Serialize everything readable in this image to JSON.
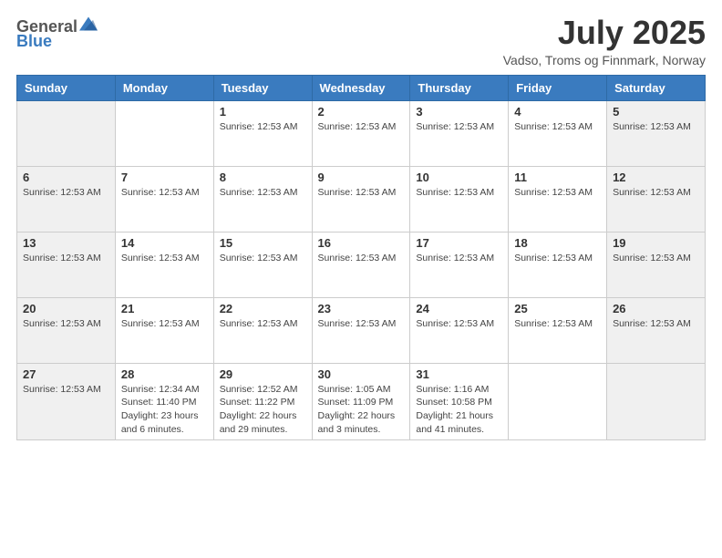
{
  "header": {
    "logo": {
      "general": "General",
      "blue": "Blue",
      "icon_title": "GeneralBlue Logo"
    },
    "title": "July 2025",
    "subtitle": "Vadso, Troms og Finnmark, Norway"
  },
  "weekdays": [
    "Sunday",
    "Monday",
    "Tuesday",
    "Wednesday",
    "Thursday",
    "Friday",
    "Saturday"
  ],
  "weeks": [
    [
      {
        "day": "",
        "info": ""
      },
      {
        "day": "",
        "info": ""
      },
      {
        "day": "1",
        "info": "Sunrise: 12:53 AM"
      },
      {
        "day": "2",
        "info": "Sunrise: 12:53 AM"
      },
      {
        "day": "3",
        "info": "Sunrise: 12:53 AM"
      },
      {
        "day": "4",
        "info": "Sunrise: 12:53 AM"
      },
      {
        "day": "5",
        "info": "Sunrise: 12:53 AM"
      }
    ],
    [
      {
        "day": "6",
        "info": "Sunrise: 12:53 AM"
      },
      {
        "day": "7",
        "info": "Sunrise: 12:53 AM"
      },
      {
        "day": "8",
        "info": "Sunrise: 12:53 AM"
      },
      {
        "day": "9",
        "info": "Sunrise: 12:53 AM"
      },
      {
        "day": "10",
        "info": "Sunrise: 12:53 AM"
      },
      {
        "day": "11",
        "info": "Sunrise: 12:53 AM"
      },
      {
        "day": "12",
        "info": "Sunrise: 12:53 AM"
      }
    ],
    [
      {
        "day": "13",
        "info": "Sunrise: 12:53 AM"
      },
      {
        "day": "14",
        "info": "Sunrise: 12:53 AM"
      },
      {
        "day": "15",
        "info": "Sunrise: 12:53 AM"
      },
      {
        "day": "16",
        "info": "Sunrise: 12:53 AM"
      },
      {
        "day": "17",
        "info": "Sunrise: 12:53 AM"
      },
      {
        "day": "18",
        "info": "Sunrise: 12:53 AM"
      },
      {
        "day": "19",
        "info": "Sunrise: 12:53 AM"
      }
    ],
    [
      {
        "day": "20",
        "info": "Sunrise: 12:53 AM"
      },
      {
        "day": "21",
        "info": "Sunrise: 12:53 AM"
      },
      {
        "day": "22",
        "info": "Sunrise: 12:53 AM"
      },
      {
        "day": "23",
        "info": "Sunrise: 12:53 AM"
      },
      {
        "day": "24",
        "info": "Sunrise: 12:53 AM"
      },
      {
        "day": "25",
        "info": "Sunrise: 12:53 AM"
      },
      {
        "day": "26",
        "info": "Sunrise: 12:53 AM"
      }
    ],
    [
      {
        "day": "27",
        "info": "Sunrise: 12:53 AM"
      },
      {
        "day": "28",
        "info": "Sunrise: 12:34 AM\nSunset: 11:40 PM\nDaylight: 23 hours and 6 minutes."
      },
      {
        "day": "29",
        "info": "Sunrise: 12:52 AM\nSunset: 11:22 PM\nDaylight: 22 hours and 29 minutes."
      },
      {
        "day": "30",
        "info": "Sunrise: 1:05 AM\nSunset: 11:09 PM\nDaylight: 22 hours and 3 minutes."
      },
      {
        "day": "31",
        "info": "Sunrise: 1:16 AM\nSunset: 10:58 PM\nDaylight: 21 hours and 41 minutes."
      },
      {
        "day": "",
        "info": ""
      },
      {
        "day": "",
        "info": ""
      }
    ]
  ],
  "shaded_cols": [
    0,
    6
  ]
}
